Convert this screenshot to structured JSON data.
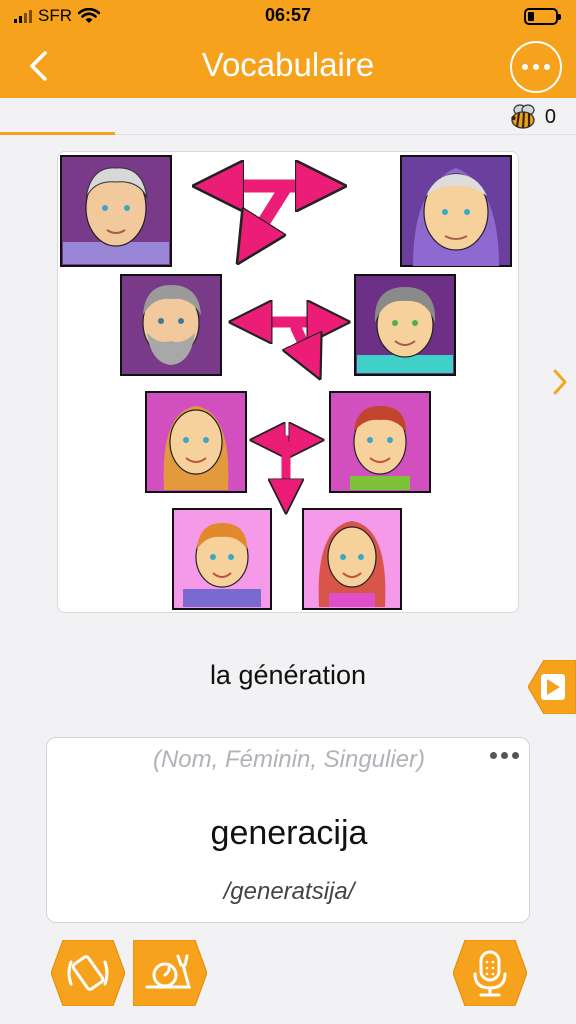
{
  "status": {
    "carrier": "SFR",
    "time": "06:57",
    "battery_level": 0.22
  },
  "nav": {
    "title": "Vocabulaire",
    "back_icon": "chevron-left-icon",
    "more_icon": "more-horizontal-icon"
  },
  "progress": {
    "fraction": 0.2,
    "score": "0",
    "score_icon": "bee-icon"
  },
  "card": {
    "image_subject": "family-generations-illustration",
    "word": "la génération",
    "grammar": "(Nom, Féminin, Singulier)",
    "translation": "generacija",
    "phonetic": "/generatsija/"
  },
  "controls": {
    "next_icon": "chevron-right-icon",
    "play_icon": "play-icon",
    "audio_icon": "vibration-icon",
    "slow_icon": "snail-icon",
    "mic_icon": "microphone-icon"
  },
  "colors": {
    "accent": "#f7a21c",
    "arrow": "#ec1d76",
    "background": "#f2f2f4"
  }
}
